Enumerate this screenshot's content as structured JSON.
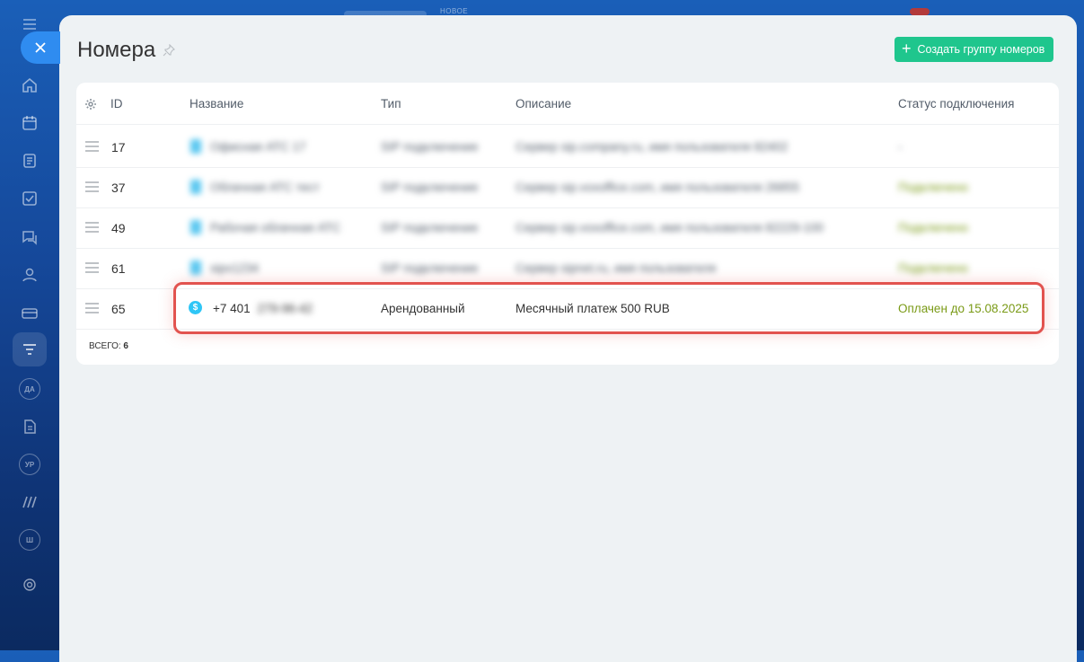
{
  "header": {
    "ghost_label": "НОВОЕ"
  },
  "page": {
    "title": "Номера",
    "create_button": "Создать группу номеров"
  },
  "table": {
    "columns": [
      "ID",
      "Название",
      "Тип",
      "Описание",
      "Статус подключения"
    ],
    "rows": [
      {
        "id": "17",
        "name": "Офисная АТС 17",
        "type": "SIP подключение",
        "description": "Сервер sip.company.ru, имя пользователя 82402",
        "status": "-",
        "blurred": true
      },
      {
        "id": "37",
        "name": "Облачная АТС тест",
        "type": "SIP подключение",
        "description": "Сервер sip.voxoffice.com, имя пользователя 26855",
        "status": "Подключено",
        "blurred": true
      },
      {
        "id": "49",
        "name": "Рабочая облачная АТС",
        "type": "SIP подключение",
        "description": "Сервер sip.voxoffice.com, имя пользователя 82229-100",
        "status": "Подключено",
        "blurred": true
      },
      {
        "id": "61",
        "name": "sipx1234",
        "type": "SIP подключение",
        "description": "Сервер sipnet.ru, имя пользователя",
        "status": "Подключено",
        "blurred": true
      },
      {
        "id": "65",
        "name_visible": "+7 401",
        "name_blurred": "279-96-42",
        "type": "Арендованный",
        "description": "Месячный платеж 500 RUB",
        "status": "Оплачен до 15.08.2025",
        "blurred": false
      }
    ],
    "total_label": "ВСЕГО:",
    "total_value": "6"
  },
  "colors": {
    "accent_green": "#1fc68d",
    "status_green": "#7a9a16",
    "highlight_red": "#e2534f",
    "coin_blue": "#2fc6f6"
  },
  "icons": [
    "close-icon",
    "home-icon",
    "calendar-icon",
    "document-icon",
    "checkbox-icon",
    "chat-icon",
    "users-icon",
    "card-icon",
    "filter-icon",
    "pin-icon",
    "gear-icon",
    "drag-handle-icon",
    "coin-icon"
  ]
}
